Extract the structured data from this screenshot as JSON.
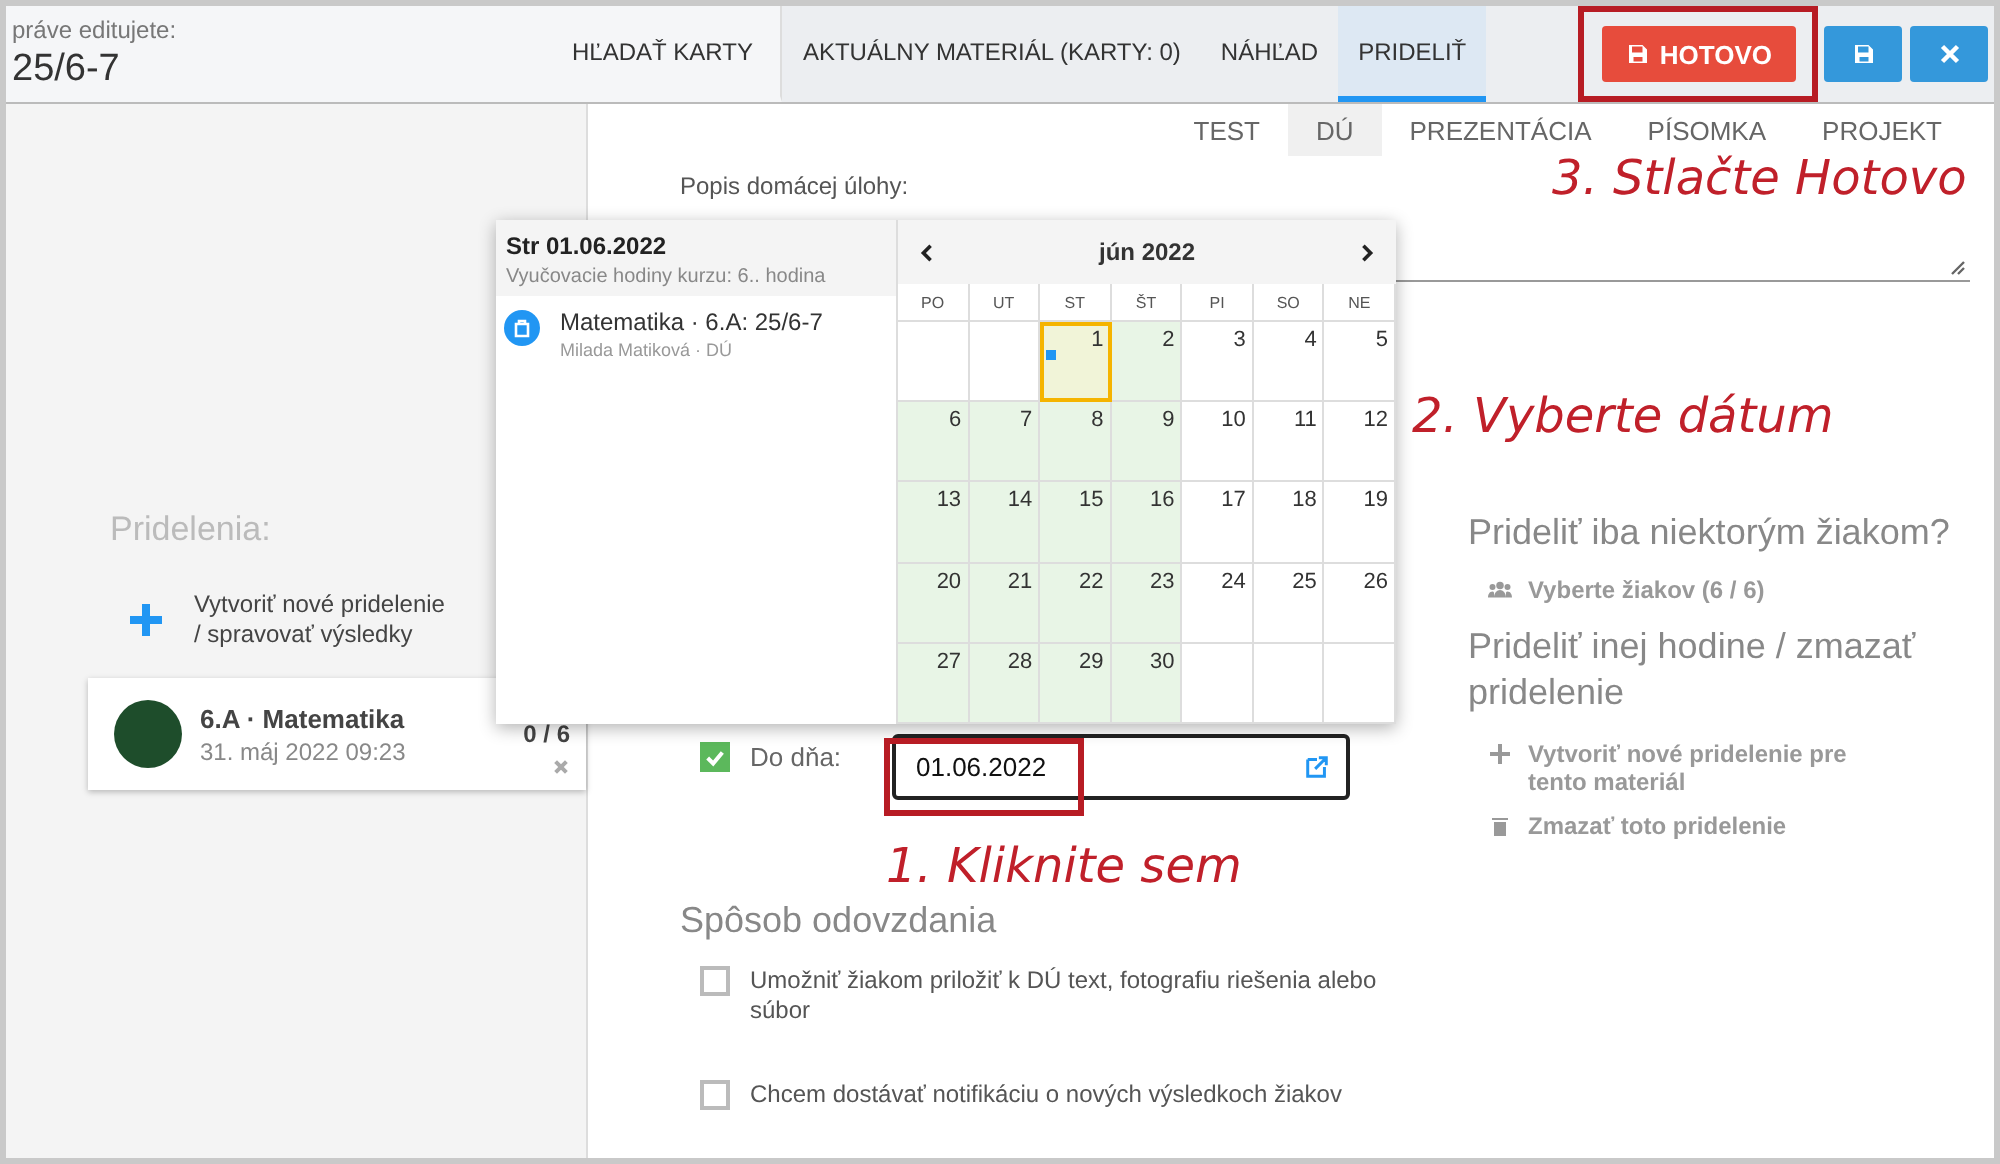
{
  "header": {
    "caption": "práve editujete:",
    "title": "25/6-7"
  },
  "tabs": [
    {
      "label": "HĽADAŤ KARTY",
      "selected": false
    },
    {
      "label": "AKTUÁLNY MATERIÁL (KARTY: 0)",
      "selected": false
    },
    {
      "label": "NÁHĽAD",
      "selected": false
    },
    {
      "label": "PRIDELIŤ",
      "selected": true
    }
  ],
  "actions": [
    {
      "kind": "done",
      "label": "HOTOVO"
    },
    {
      "kind": "save"
    },
    {
      "kind": "close"
    }
  ],
  "sidebar": {
    "heading": "Pridelenia:",
    "create_link": [
      "Vytvoriť nové pridelenie",
      "/ spravovať výsledky"
    ],
    "assignments": [
      {
        "title": "6.A · Matematika",
        "date": "31. máj 2022 09:23",
        "count": "0 / 6"
      }
    ]
  },
  "type_tabs": [
    {
      "label": "TEST",
      "selected": false
    },
    {
      "label": "DÚ",
      "selected": true
    },
    {
      "label": "PREZENTÁCIA",
      "selected": false
    },
    {
      "label": "PÍSOMKA",
      "selected": false
    },
    {
      "label": "PROJEKT",
      "selected": false
    }
  ],
  "description_label": "Popis domácej úlohy:",
  "due": {
    "checked": true,
    "label": "Do dňa:",
    "value": "01.06.2022"
  },
  "submission": {
    "heading": "Spôsob odovzdania",
    "options": [
      {
        "label": "Umožniť žiakom priložiť k DÚ text, fotografiu riešenia alebo súbor",
        "checked": false
      },
      {
        "label": "Chcem dostávať notifikáciu o nových výsledkoch žiakov",
        "checked": false
      }
    ]
  },
  "targeting": {
    "heading": "Prideliť iba niektorým žiakom?",
    "link": "Vyberte žiakov (6 / 6)"
  },
  "reassign": {
    "heading": "Prideliť inej hodine / zmazať pridelenie",
    "actions": [
      {
        "kind": "create",
        "label": "Vytvoriť nové pridelenie pre tento materiál"
      },
      {
        "kind": "delete",
        "label": "Zmazať toto pridelenie"
      }
    ]
  },
  "calendar_popup": {
    "day_title": "Str 01.06.2022",
    "day_subtitle": "Vyučovacie hodiny kurzu: 6.. hodina",
    "events": [
      {
        "title": "Matematika · 6.A: 25/6-7",
        "subtitle": "Milada Matiková · DÚ"
      }
    ],
    "month": "jún 2022",
    "weekdays": [
      "PO",
      "UT",
      "ST",
      "ŠT",
      "PI",
      "SO",
      "NE"
    ],
    "weeks": [
      {
        "days": [
          {
            "label": "1",
            "in_range": true,
            "selected": true,
            "marked": true
          },
          {
            "label": "2",
            "in_range": true,
            "selected": false,
            "marked": false
          },
          {
            "label": "3",
            "in_range": false,
            "selected": false,
            "marked": false
          },
          {
            "label": "4",
            "in_range": false,
            "selected": false,
            "marked": false
          },
          {
            "label": "5",
            "in_range": false,
            "selected": false,
            "marked": false
          }
        ]
      },
      {
        "days": [
          {
            "label": "6",
            "in_range": true,
            "selected": false,
            "marked": false
          },
          {
            "label": "7",
            "in_range": true,
            "selected": false,
            "marked": false
          },
          {
            "label": "8",
            "in_range": true,
            "selected": false,
            "marked": false
          },
          {
            "label": "9",
            "in_range": true,
            "selected": false,
            "marked": false
          },
          {
            "label": "10",
            "in_range": false,
            "selected": false,
            "marked": false
          },
          {
            "label": "11",
            "in_range": false,
            "selected": false,
            "marked": false
          },
          {
            "label": "12",
            "in_range": false,
            "selected": false,
            "marked": false
          }
        ]
      },
      {
        "days": [
          {
            "label": "13",
            "in_range": true,
            "selected": false,
            "marked": false
          },
          {
            "label": "14",
            "in_range": true,
            "selected": false,
            "marked": false
          },
          {
            "label": "15",
            "in_range": true,
            "selected": false,
            "marked": false
          },
          {
            "label": "16",
            "in_range": true,
            "selected": false,
            "marked": false
          },
          {
            "label": "17",
            "in_range": false,
            "selected": false,
            "marked": false
          },
          {
            "label": "18",
            "in_range": false,
            "selected": false,
            "marked": false
          },
          {
            "label": "19",
            "in_range": false,
            "selected": false,
            "marked": false
          }
        ]
      },
      {
        "days": [
          {
            "label": "20",
            "in_range": true,
            "selected": false,
            "marked": false
          },
          {
            "label": "21",
            "in_range": true,
            "selected": false,
            "marked": false
          },
          {
            "label": "22",
            "in_range": true,
            "selected": false,
            "marked": false
          },
          {
            "label": "23",
            "in_range": true,
            "selected": false,
            "marked": false
          },
          {
            "label": "24",
            "in_range": false,
            "selected": false,
            "marked": false
          },
          {
            "label": "25",
            "in_range": false,
            "selected": false,
            "marked": false
          },
          {
            "label": "26",
            "in_range": false,
            "selected": false,
            "marked": false
          }
        ]
      },
      {
        "days": [
          {
            "label": "27",
            "in_range": true,
            "selected": false,
            "marked": false
          },
          {
            "label": "28",
            "in_range": true,
            "selected": false,
            "marked": false
          },
          {
            "label": "29",
            "in_range": true,
            "selected": false,
            "marked": false
          },
          {
            "label": "30",
            "in_range": true,
            "selected": false,
            "marked": false
          }
        ]
      }
    ]
  },
  "annotations": [
    "3. Stlačte Hotovo",
    "2. Vyberte dátum",
    "1. Kliknite sem"
  ]
}
